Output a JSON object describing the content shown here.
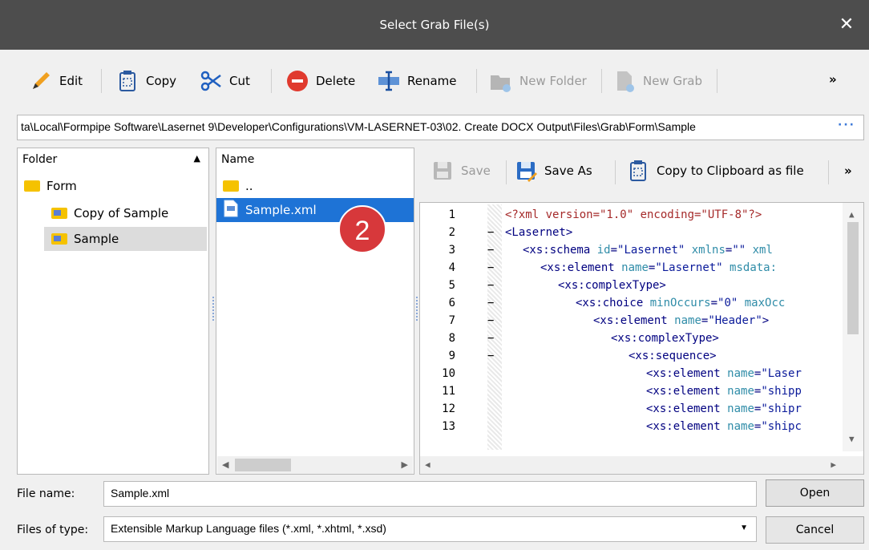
{
  "window": {
    "title": "Select Grab File(s)",
    "close_glyph": "✕"
  },
  "toolbar": {
    "edit_label": "Edit",
    "copy_label": "Copy",
    "cut_label": "Cut",
    "delete_label": "Delete",
    "rename_label": "Rename",
    "new_folder_label": "New Folder",
    "new_grab_label": "New Grab",
    "more_glyph": "»"
  },
  "path": {
    "value": "ta\\Local\\Formpipe Software\\Lasernet 9\\Developer\\Configurations\\VM-LASERNET-03\\02. Create DOCX Output\\Files\\Grab\\Form\\Sample",
    "more_glyph": "···"
  },
  "folder_pane": {
    "header": "Folder",
    "sort_glyph": "▲",
    "items": [
      {
        "label": "Form"
      },
      {
        "label": "Copy of Sample"
      },
      {
        "label": "Sample"
      }
    ]
  },
  "file_pane": {
    "header": "Name",
    "items": [
      {
        "label": ".."
      },
      {
        "label": "Sample.xml"
      }
    ]
  },
  "editor_toolbar": {
    "save_label": "Save",
    "save_as_label": "Save As",
    "copy_clipboard_label": "Copy to Clipboard as file",
    "more_glyph": "»"
  },
  "editor": {
    "line_numbers": [
      "1",
      "2",
      "3",
      "4",
      "5",
      "6",
      "7",
      "8",
      "9",
      "10",
      "11",
      "12",
      "13"
    ],
    "fold_marks": [
      "",
      "−",
      "−",
      "−",
      "−",
      "−",
      "−",
      "−",
      "−",
      "",
      "",
      "",
      ""
    ]
  },
  "footer": {
    "file_name_label": "File name:",
    "file_name_value": "Sample.xml",
    "files_of_type_label": "Files of type:",
    "files_of_type_value": "Extensible Markup Language files (*.xml, *.xhtml, *.xsd)",
    "open_label": "Open",
    "cancel_label": "Cancel"
  },
  "step_badge": "2",
  "colors": {
    "selection": "#1e73d6",
    "titlebar": "#4d4d4d",
    "badge": "#d7383b"
  }
}
